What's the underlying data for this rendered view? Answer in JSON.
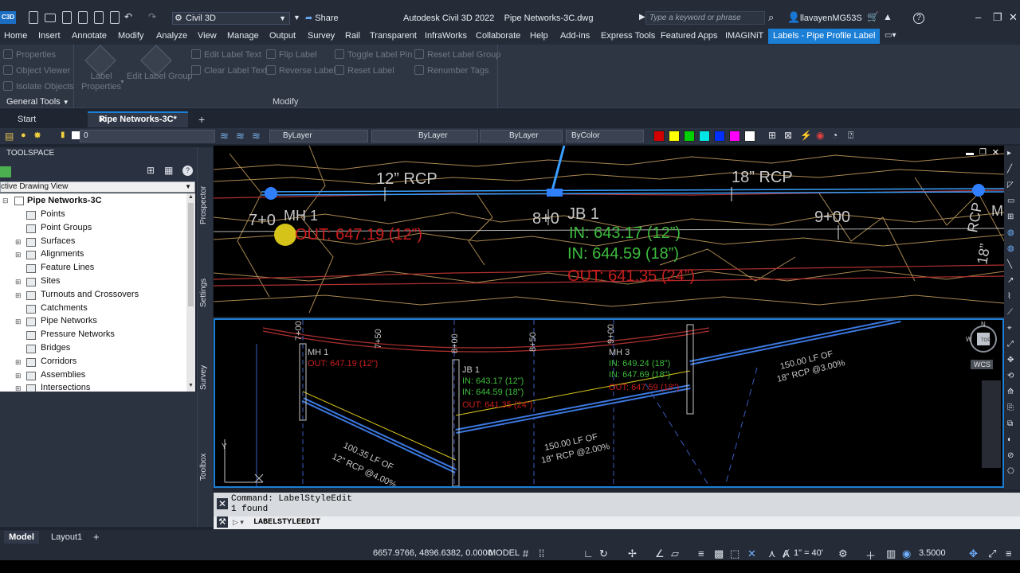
{
  "titlebar": {
    "logo_text": "C3D",
    "workspace": "Civil 3D",
    "share_label": "Share",
    "title": "Autodesk Civil 3D 2022    Pipe Networks-3C.dwg",
    "search_placeholder": "Type a keyword or phrase",
    "user": "llavayenMG53S",
    "help": "?",
    "min": "–",
    "restore": "❐",
    "close": "✕"
  },
  "menu_tabs": [
    "Home",
    "Insert",
    "Annotate",
    "Modify",
    "Analyze",
    "View",
    "Manage",
    "Output",
    "Survey",
    "Rail",
    "Transparent",
    "InfraWorks",
    "Collaborate",
    "Help",
    "Add-ins",
    "Express Tools",
    "Featured Apps",
    "IMAGINiT"
  ],
  "active_tab": "Labels - Pipe Profile Label",
  "ribbon": {
    "general": [
      "Properties",
      "Object Viewer",
      "Isolate Objects"
    ],
    "label_properties": "Label\nProperties",
    "edit_label_group": "Edit Label Group",
    "modify_col1": [
      "Edit Label Text",
      "Clear Label Text"
    ],
    "modify_col2": [
      "Flip Label",
      "Reverse Label"
    ],
    "modify_col3": [
      "Toggle Label Pin",
      "Reset Label"
    ],
    "modify_col4": [
      "Reset Label Group",
      "Renumber Tags"
    ],
    "panel_general": "General Tools",
    "panel_modify": "Modify"
  },
  "doc_tabs": {
    "start": "Start",
    "active": "Pipe Networks-3C*",
    "close": "✕",
    "add": "+"
  },
  "prop_toolbar": {
    "layer_value": "0",
    "color": "ByLayer",
    "linetype": "ByLayer",
    "lineweight": "ByLayer",
    "plotstyle": "ByColor",
    "swatches": [
      "#d40000",
      "#ffff00",
      "#00d000",
      "#00e5e5",
      "#0030ff",
      "#ff00ff",
      "#ffffff"
    ]
  },
  "toolspace": {
    "title": "TOOLSPACE",
    "view_select": "ctive Drawing View",
    "root": "Pipe Networks-3C",
    "items": [
      {
        "label": "Points",
        "expandable": false
      },
      {
        "label": "Point Groups",
        "expandable": false
      },
      {
        "label": "Surfaces",
        "expandable": true
      },
      {
        "label": "Alignments",
        "expandable": true
      },
      {
        "label": "Feature Lines",
        "expandable": false
      },
      {
        "label": "Sites",
        "expandable": true
      },
      {
        "label": "Turnouts and Crossovers",
        "expandable": true
      },
      {
        "label": "Catchments",
        "expandable": false
      },
      {
        "label": "Pipe Networks",
        "expandable": true
      },
      {
        "label": "Pressure Networks",
        "expandable": false
      },
      {
        "label": "Bridges",
        "expandable": false
      },
      {
        "label": "Corridors",
        "expandable": true
      },
      {
        "label": "Assemblies",
        "expandable": true
      },
      {
        "label": "Intersections",
        "expandable": true
      }
    ],
    "side_tabs": [
      "Prospector",
      "Settings",
      "Survey",
      "Toolbox"
    ]
  },
  "viewport_top": {
    "labels": {
      "pipe_12": "12” RCP",
      "pipe_18": "18” RCP",
      "pipe_rcp_right": "RCP",
      "pipe_18_right": "18”",
      "sta_700": "7+0",
      "sta_800": "8+0",
      "sta_900": "9+00",
      "mh1": "MH 1",
      "mh1_out": "OUT: 647.19 (12”)",
      "jb1": "JB 1",
      "jb1_in1": "IN: 643.17 (12”)",
      "jb1_in2": "IN: 644.59 (18”)",
      "jb1_out": "OUT: 641.35 (24”)",
      "edge_m": "M"
    }
  },
  "viewport_bottom": {
    "stations": [
      "7+00",
      "7+50",
      "8+00",
      "8+50",
      "9+00"
    ],
    "mh1": "MH 1",
    "mh1_out": "OUT: 647.19 (12\")",
    "jb1": "JB 1",
    "jb1_in1": "IN: 643.17 (12\")",
    "jb1_in2": "IN: 644.59 (18\")",
    "jb1_out": "OUT: 641.35 (24\")",
    "mh3": "MH 3",
    "mh3_in1": "IN: 649.24 (18\")",
    "mh3_in2": "IN: 647.69 (18\")",
    "mh3_out": "OUT: 647.59 (18\")",
    "pipe_a_l1": "100.35 LF OF",
    "pipe_a_l2": "12\" RCP @4.00%",
    "pipe_b_l1": "150.00 LF OF",
    "pipe_b_l2": "18\" RCP @2.00%",
    "pipe_c_l1": "150.00 LF OF",
    "pipe_c_l2": "18\" RCP @3.00%",
    "compass_n": "N",
    "compass_w": "W",
    "compass_top": "TOP",
    "wcs": "WCS",
    "ucs_y": "Y"
  },
  "command": {
    "line1": "Command: LabelStyleEdit",
    "line2": "1 found",
    "input": "LABELSTYLEEDIT",
    "close": "✕",
    "wrench": "⚒"
  },
  "statusbar": {
    "model_tab": "Model",
    "layout_tab": "Layout1",
    "add_tab": "+",
    "coords": "6657.9766, 4896.6382, 0.0000",
    "model": "MODEL",
    "scale": "1\" = 40'",
    "zoom": "3.5000"
  }
}
